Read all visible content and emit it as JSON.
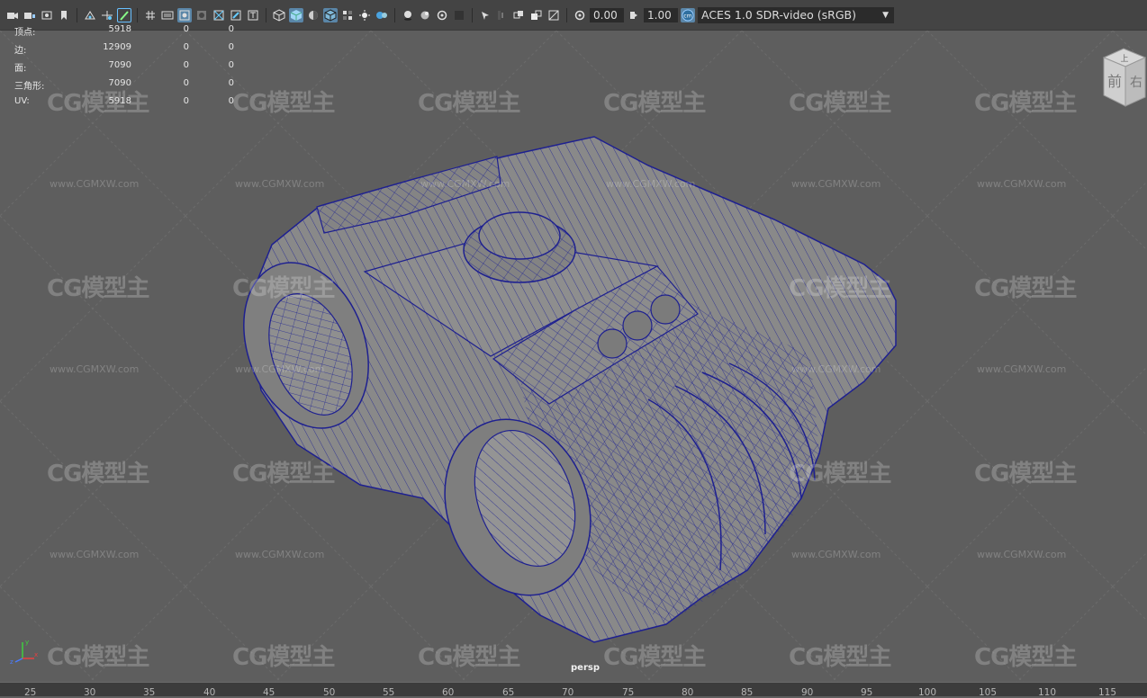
{
  "toolbar": {
    "icons": [
      "camera-icon",
      "camera-lock-icon",
      "bookmark-icon",
      "bookmark-flag-icon",
      "image-plane-icon",
      "pan-zoom-icon",
      "grease-pencil-icon",
      "grid-icon",
      "film-gate-icon",
      "resolution-gate-icon",
      "gate-mask-icon",
      "field-chart-icon",
      "safe-action-icon",
      "safe-title-icon",
      "wireframe-icon",
      "smooth-shade-icon",
      "default-material-icon",
      "wireframe-on-shaded-icon",
      "xray-icon",
      "textured-icon",
      "use-all-lights-icon",
      "shadows-icon",
      "screen-space-ao-icon",
      "motion-blur-icon",
      "anti-aliasing-icon",
      "depth-of-field-icon",
      "isolate-select-icon",
      "xray-joints-icon",
      "xray-active-icon",
      "backface-cull-icon",
      "exposure-icon",
      "gamma-icon",
      "color-management-icon"
    ],
    "exposure": "0.00",
    "gamma": "1.00",
    "color_space": "ACES 1.0 SDR-video (sRGB)"
  },
  "hud": {
    "rows": [
      {
        "label": "顶点:",
        "v1": "5918",
        "v2": "0",
        "v3": "0"
      },
      {
        "label": "边:",
        "v1": "12909",
        "v2": "0",
        "v3": "0"
      },
      {
        "label": "面:",
        "v1": "7090",
        "v2": "0",
        "v3": "0"
      },
      {
        "label": "三角形:",
        "v1": "7090",
        "v2": "0",
        "v3": "0"
      },
      {
        "label": "UV:",
        "v1": "5918",
        "v2": "0",
        "v3": "0"
      }
    ]
  },
  "viewcube": {
    "top": "上",
    "front": "前",
    "right": "右"
  },
  "watermark": {
    "logo": "CG模型主",
    "url": "www.CGMXW.com"
  },
  "camera_label": "persp",
  "axis": {
    "x": "x",
    "y": "y",
    "z": "z"
  },
  "ruler": {
    "ticks": [
      "25",
      "30",
      "35",
      "40",
      "45",
      "50",
      "55",
      "60",
      "65",
      "70",
      "75",
      "80",
      "85",
      "90",
      "95",
      "100",
      "105",
      "110",
      "115"
    ]
  },
  "colors": {
    "viewport_bg": "#5e5e5e",
    "wire": "#1e2090",
    "mesh": "#8a8a8a",
    "toolbar_bg": "#444444",
    "highlight": "#5a86a8"
  }
}
